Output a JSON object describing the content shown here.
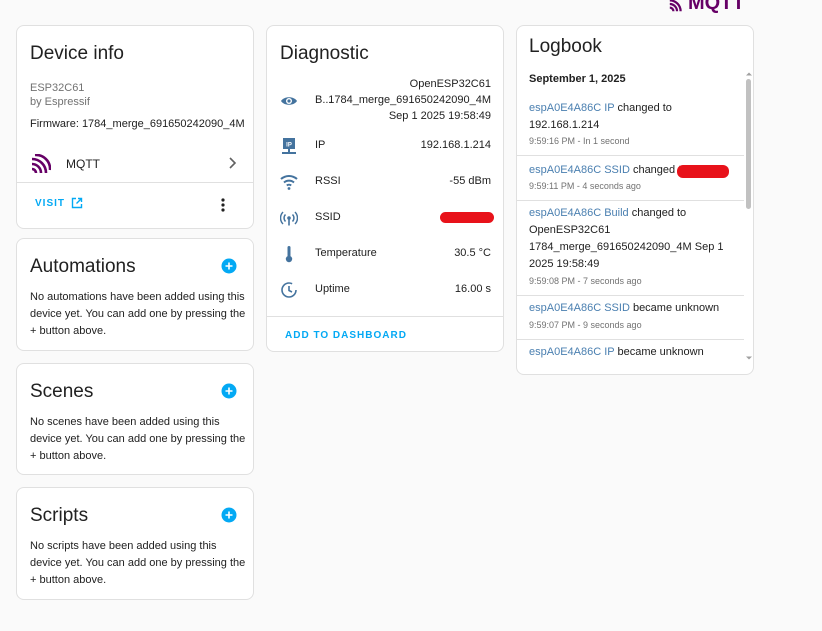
{
  "brand": {
    "logo_text": "MQTT",
    "color": "#660066"
  },
  "device_info": {
    "title": "Device info",
    "model": "ESP32C61",
    "manufacturer": "by Espressif",
    "firmware": "Firmware: 1784_merge_691650242090_4M",
    "integration": {
      "name": "MQTT",
      "icon": "mqtt-icon"
    },
    "visit_label": "VISIT"
  },
  "automations": {
    "title": "Automations",
    "description": "No automations have been added using this device yet. You can add one by pressing the + button above."
  },
  "scenes": {
    "title": "Scenes",
    "description": "No scenes have been added using this device yet. You can add one by pressing the + button above."
  },
  "scripts": {
    "title": "Scripts",
    "description": "No scripts have been added using this device yet. You can add one by pressing the + button above."
  },
  "diagnostic": {
    "title": "Diagnostic",
    "build": {
      "name": "B...",
      "value_line1": "OpenESP32C61",
      "value_line2": "1784_merge_691650242090_4M",
      "value_line3": "Sep 1 2025 19:58:49",
      "icon": "eye-icon"
    },
    "ip": {
      "name": "IP",
      "value": "192.168.1.214",
      "icon": "ip-network-icon"
    },
    "rssi": {
      "name": "RSSI",
      "value": "-55 dBm",
      "icon": "wifi-icon"
    },
    "ssid": {
      "name": "SSID",
      "icon": "access-point-icon"
    },
    "temperature": {
      "name": "Temperature",
      "value": "30.5 °C",
      "icon": "thermometer-icon"
    },
    "uptime": {
      "name": "Uptime",
      "value": "16.00 s",
      "icon": "clock-icon"
    },
    "add_to_dashboard": "ADD TO DASHBOARD"
  },
  "logbook": {
    "title": "Logbook",
    "date": "September 1, 2025",
    "entries": [
      {
        "entity": "espA0E4A86C IP",
        "message": " changed to 192.168.1.214",
        "time": "9:59:16 PM - In 1 second"
      },
      {
        "entity": "espA0E4A86C SSID",
        "message": " changed to ",
        "time": "9:59:11 PM - 4 seconds ago"
      },
      {
        "entity": "espA0E4A86C Build",
        "message": " changed to OpenESP32C61 1784_merge_691650242090_4M Sep 1 2025 19:58:49",
        "time": "9:59:08 PM - 7 seconds ago"
      },
      {
        "entity": "espA0E4A86C SSID",
        "message": " became unknown",
        "time": "9:59:07 PM - 9 seconds ago"
      },
      {
        "entity": "espA0E4A86C IP",
        "message": " became unknown",
        "time": ""
      }
    ]
  },
  "colors": {
    "accent": "#03a9f4",
    "redaction": "#e8121a",
    "link": "#4a7fb0"
  }
}
